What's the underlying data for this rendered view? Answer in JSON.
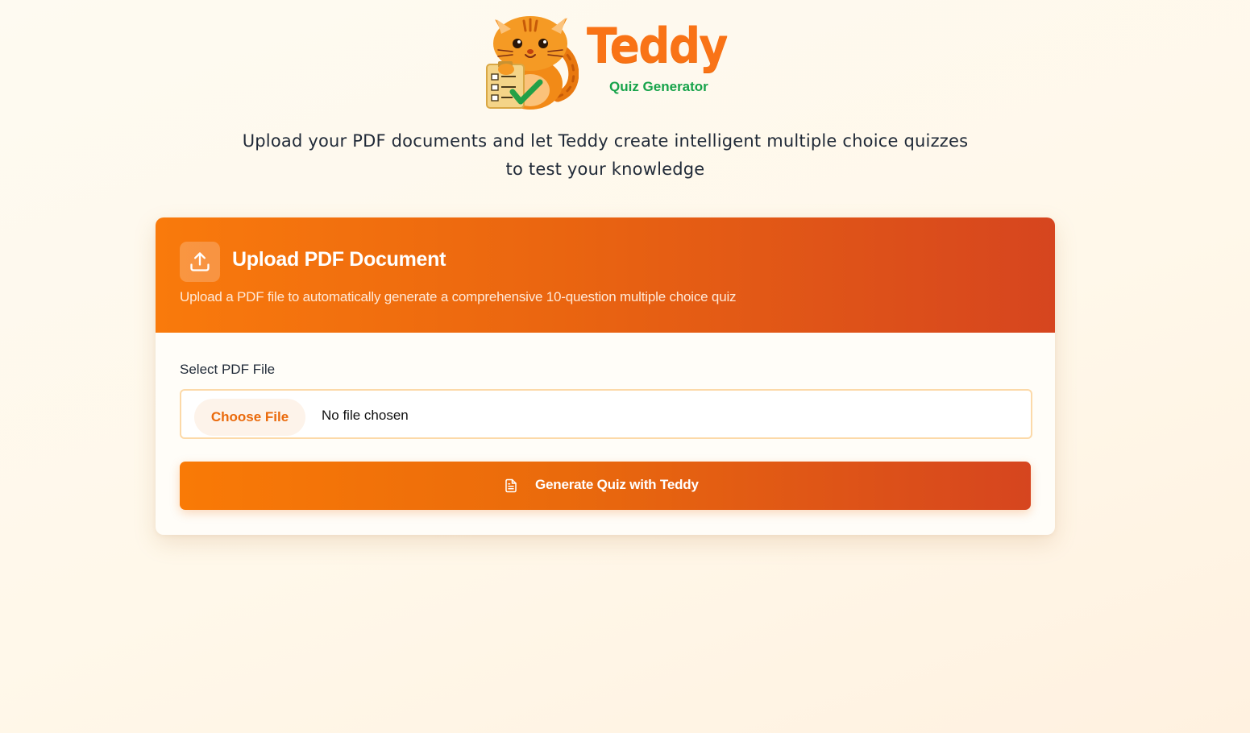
{
  "brand": {
    "name": "Teddy",
    "subtitle": "Quiz Generator",
    "mascot_icon": "cat-with-checklist-icon",
    "colors": {
      "primary": "#f97316",
      "secondary": "#16a34a"
    }
  },
  "tagline": "Upload your PDF documents and let Teddy create intelligent multiple choice quizzes to test your knowledge",
  "upload_card": {
    "icon": "upload-icon",
    "title": "Upload PDF Document",
    "description": "Upload a PDF file to automatically generate a comprehensive 10-question multiple choice quiz",
    "field_label": "Select PDF File",
    "file_input": {
      "button_label": "Choose File",
      "status": "No file chosen"
    },
    "generate_button": {
      "icon": "document-icon",
      "label": "Generate Quiz with Teddy"
    },
    "header_gradient": [
      "#f97a0c",
      "#d6451f"
    ]
  }
}
